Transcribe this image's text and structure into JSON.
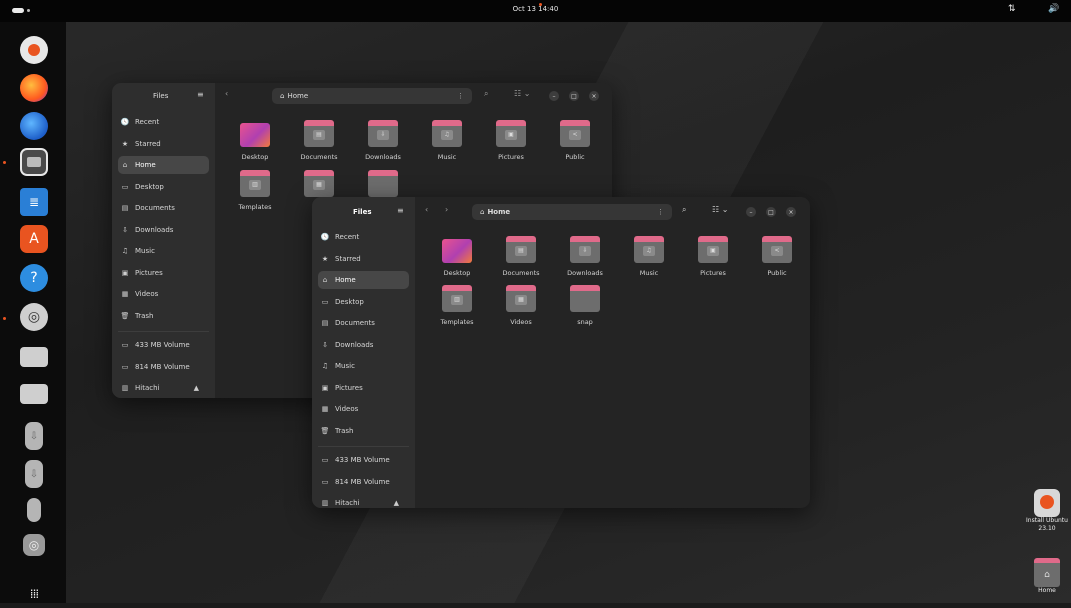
{
  "topbar": {
    "clock": "Oct 13 14:40"
  },
  "dock": {
    "items": [
      {
        "name": "Install Ubuntu"
      },
      {
        "name": "Firefox"
      },
      {
        "name": "Thunderbird"
      },
      {
        "name": "Files"
      },
      {
        "name": "LibreOffice Writer"
      },
      {
        "name": "App Center"
      },
      {
        "name": "Help"
      },
      {
        "name": "Ubuntu Settings"
      },
      {
        "name": "Drive 1"
      },
      {
        "name": "Drive 2"
      },
      {
        "name": "USB 1"
      },
      {
        "name": "USB 2"
      },
      {
        "name": "USB 3"
      },
      {
        "name": "Optical Drive"
      },
      {
        "name": "Show Apps"
      }
    ]
  },
  "back_window": {
    "title": "Files",
    "path": "Home",
    "sidebar": [
      {
        "icon": "🕓",
        "label": "Recent"
      },
      {
        "icon": "★",
        "label": "Starred"
      },
      {
        "icon": "⌂",
        "label": "Home",
        "active": true
      },
      {
        "icon": "▭",
        "label": "Desktop"
      },
      {
        "icon": "▤",
        "label": "Documents"
      },
      {
        "icon": "⇩",
        "label": "Downloads"
      },
      {
        "icon": "♫",
        "label": "Music"
      },
      {
        "icon": "▣",
        "label": "Pictures"
      },
      {
        "icon": "▦",
        "label": "Videos"
      },
      {
        "icon": "🗑",
        "label": "Trash"
      }
    ],
    "volumes": [
      {
        "icon": "▭",
        "label": "433 MB Volume"
      },
      {
        "icon": "▭",
        "label": "814 MB Volume"
      },
      {
        "icon": "▥",
        "label": "Hitachi",
        "eject": "▲"
      }
    ],
    "folders": [
      {
        "label": "Desktop",
        "glyph": ""
      },
      {
        "label": "Documents",
        "glyph": "▤"
      },
      {
        "label": "Downloads",
        "glyph": "⇩"
      },
      {
        "label": "Music",
        "glyph": "♫"
      },
      {
        "label": "Pictures",
        "glyph": "▣"
      },
      {
        "label": "Public",
        "glyph": "<"
      },
      {
        "label": "Templates",
        "glyph": "▥"
      },
      {
        "label": "Vi",
        "glyph": "▦"
      },
      {
        "label": "",
        "glyph": ""
      }
    ]
  },
  "front_window": {
    "title": "Files",
    "path": "Home",
    "sidebar": [
      {
        "icon": "🕓",
        "label": "Recent"
      },
      {
        "icon": "★",
        "label": "Starred"
      },
      {
        "icon": "⌂",
        "label": "Home",
        "active": true
      },
      {
        "icon": "▭",
        "label": "Desktop"
      },
      {
        "icon": "▤",
        "label": "Documents"
      },
      {
        "icon": "⇩",
        "label": "Downloads"
      },
      {
        "icon": "♫",
        "label": "Music"
      },
      {
        "icon": "▣",
        "label": "Pictures"
      },
      {
        "icon": "▦",
        "label": "Videos"
      },
      {
        "icon": "🗑",
        "label": "Trash"
      }
    ],
    "volumes": [
      {
        "icon": "▭",
        "label": "433 MB Volume"
      },
      {
        "icon": "▭",
        "label": "814 MB Volume"
      },
      {
        "icon": "▥",
        "label": "Hitachi",
        "eject": "▲"
      }
    ],
    "folders": [
      {
        "label": "Desktop",
        "glyph": ""
      },
      {
        "label": "Documents",
        "glyph": "▤"
      },
      {
        "label": "Downloads",
        "glyph": "⇩"
      },
      {
        "label": "Music",
        "glyph": "♫"
      },
      {
        "label": "Pictures",
        "glyph": "▣"
      },
      {
        "label": "Public",
        "glyph": "<"
      },
      {
        "label": "Templates",
        "glyph": "▥"
      },
      {
        "label": "Videos",
        "glyph": "▦"
      },
      {
        "label": "snap",
        "glyph": ""
      }
    ]
  },
  "desktop_icons": [
    {
      "label": "Install Ubuntu 23.10"
    },
    {
      "label": "Home"
    }
  ],
  "colors": {
    "accent": "#e95420",
    "window_bg": "#242424",
    "sidebar_bg": "#2e2e2e",
    "folder_tab": "#e06a8a"
  }
}
